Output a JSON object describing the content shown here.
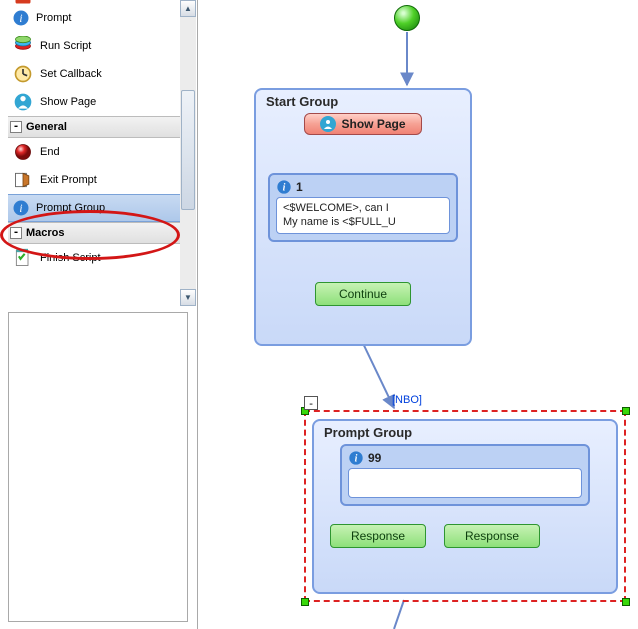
{
  "sidebar": {
    "items_top": [
      {
        "label": "Prompt",
        "icon": "info-icon"
      },
      {
        "label": "Run Script",
        "icon": "script-icon"
      },
      {
        "label": "Set Callback",
        "icon": "callback-icon"
      },
      {
        "label": "Show Page",
        "icon": "showpage-icon"
      }
    ],
    "header_general": "General",
    "items_general": [
      {
        "label": "End",
        "icon": "red-ball-icon"
      },
      {
        "label": "Exit Prompt",
        "icon": "exit-icon"
      },
      {
        "label": "Prompt Group",
        "icon": "info-icon",
        "selected": true
      }
    ],
    "header_macros": "Macros",
    "items_macros": [
      {
        "label": "Finish Script",
        "icon": "finish-icon"
      }
    ]
  },
  "canvas": {
    "start_group": {
      "title": "Start Group",
      "showpage_label": "Show Page",
      "prompt": {
        "id_label": "1",
        "line1": "<$WELCOME>, can I",
        "line2": "My name is <$FULL_U"
      },
      "continue_label": "Continue"
    },
    "edge_label": "[NBO]",
    "prompt_group": {
      "title": "Prompt Group",
      "prompt": {
        "id_label": "99",
        "body": ""
      },
      "response1": "Response",
      "response2": "Response"
    },
    "collapse_char": "-"
  }
}
